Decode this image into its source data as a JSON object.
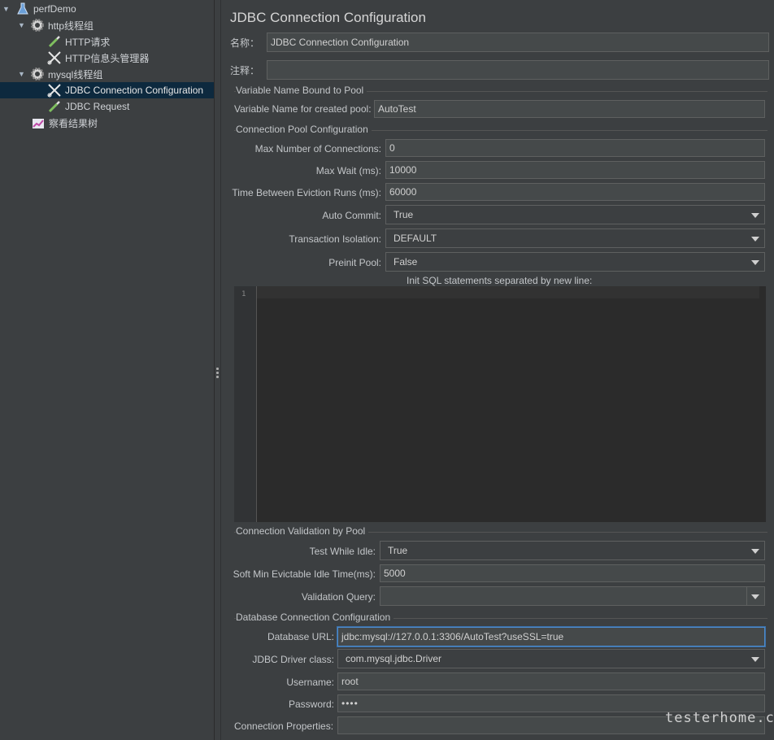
{
  "tree": {
    "items": [
      {
        "label": "perfDemo",
        "icon": "flask-icon",
        "expanded": true
      },
      {
        "label": "http线程组",
        "icon": "gear-icon",
        "expanded": true
      },
      {
        "label": "HTTP请求",
        "icon": "pipette-icon"
      },
      {
        "label": "HTTP信息头管理器",
        "icon": "wrench-scissors-icon"
      },
      {
        "label": "mysql线程组",
        "icon": "gear-icon",
        "expanded": true
      },
      {
        "label": "JDBC Connection Configuration",
        "icon": "wrench-scissors-icon",
        "selected": true
      },
      {
        "label": "JDBC Request",
        "icon": "pipette-icon"
      },
      {
        "label": "察看结果树",
        "icon": "chart-icon"
      }
    ]
  },
  "panel": {
    "title": "JDBC Connection Configuration",
    "name_label": "名称：",
    "name_value": "JDBC Connection Configuration",
    "comment_label": "注释：",
    "comment_value": "",
    "var_group_title": "Variable Name Bound to Pool",
    "var_label": "Variable Name for created pool:",
    "var_value": "AutoTest",
    "pool_group_title": "Connection Pool Configuration",
    "max_conn_label": "Max Number of Connections:",
    "max_conn_value": "0",
    "max_wait_label": "Max Wait (ms):",
    "max_wait_value": "10000",
    "eviction_label": "Time Between Eviction Runs (ms):",
    "eviction_value": "60000",
    "auto_commit_label": "Auto Commit:",
    "auto_commit_value": "True",
    "isolation_label": "Transaction Isolation:",
    "isolation_value": "DEFAULT",
    "preinit_label": "Preinit Pool:",
    "preinit_value": "False",
    "init_sql_label": "Init SQL statements separated by new line:",
    "editor_line": "1",
    "validation_group_title": "Connection Validation by Pool",
    "test_idle_label": "Test While Idle:",
    "test_idle_value": "True",
    "soft_min_label": "Soft Min Evictable Idle Time(ms):",
    "soft_min_value": "5000",
    "validation_query_label": "Validation Query:",
    "validation_query_value": "",
    "db_group_title": "Database Connection Configuration",
    "db_url_label": "Database URL:",
    "db_url_value": "jdbc:mysql://127.0.0.1:3306/AutoTest?useSSL=true",
    "driver_label": "JDBC Driver class:",
    "driver_value": "com.mysql.jdbc.Driver",
    "username_label": "Username:",
    "username_value": "root",
    "password_label": "Password:",
    "password_value": "••••",
    "conn_props_label": "Connection Properties:",
    "conn_props_value": ""
  },
  "watermark": "testerhome.com"
}
